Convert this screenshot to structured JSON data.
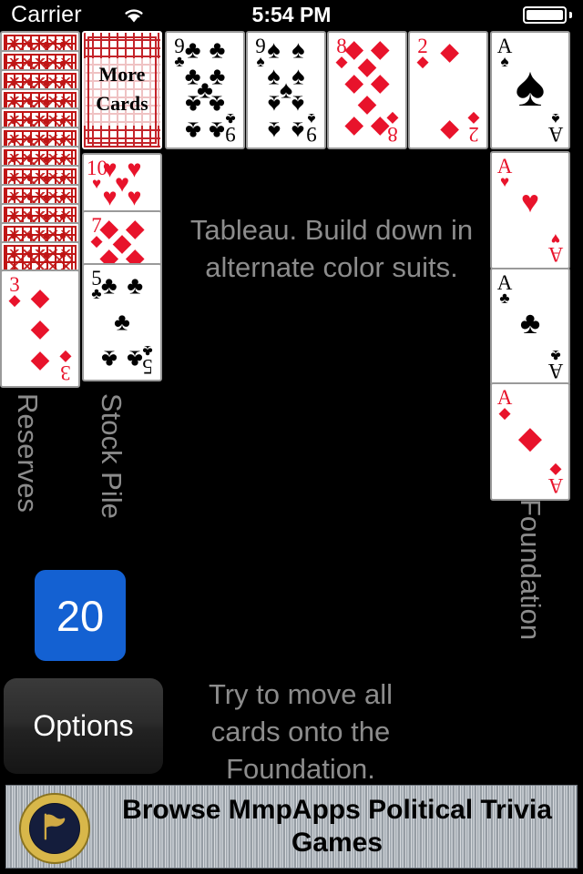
{
  "status_bar": {
    "carrier": "Carrier",
    "time": "5:54 PM",
    "wifi_icon": "wifi-icon",
    "battery_icon": "battery-full-icon"
  },
  "labels": {
    "reserves": "Reserves",
    "stock_pile": "Stock Pile",
    "foundation": "Foundation"
  },
  "hints": {
    "tableau": "Tableau. Build down in alternate color suits.",
    "goal": "Try to move all cards onto the Foundation."
  },
  "stock": {
    "more_cards_line1": "More",
    "more_cards_line2": "Cards"
  },
  "score": {
    "value": "20",
    "color": "#1461d2"
  },
  "options_button": {
    "label": "Options"
  },
  "ad": {
    "text": "Browse MmpApps Political Trivia Games",
    "seal_icon": "presidential-seal-icon"
  },
  "colors": {
    "table": "#000000",
    "label_gray": "#8c8c8c",
    "card_red": "#e8132b",
    "card_back_red": "#c01616",
    "accent_blue": "#1461d2"
  },
  "piles": {
    "reserves": {
      "face_down_count": 12,
      "face_up": [
        {
          "rank": "3",
          "suit": "diamonds",
          "color": "red"
        }
      ]
    },
    "stock_pile": {
      "top_card": "more-cards",
      "face_up": [
        {
          "rank": "10",
          "suit": "hearts",
          "color": "red"
        },
        {
          "rank": "7",
          "suit": "diamonds",
          "color": "red"
        },
        {
          "rank": "5",
          "suit": "clubs",
          "color": "black"
        }
      ]
    },
    "tableau": [
      {
        "rank": "9",
        "suit": "clubs",
        "color": "black"
      },
      {
        "rank": "9",
        "suit": "spades",
        "color": "black"
      },
      {
        "rank": "8",
        "suit": "diamonds",
        "color": "red"
      },
      {
        "rank": "2",
        "suit": "diamonds",
        "color": "red"
      }
    ],
    "foundation": [
      {
        "rank": "A",
        "suit": "spades",
        "color": "black"
      },
      {
        "rank": "A",
        "suit": "hearts",
        "color": "red"
      },
      {
        "rank": "A",
        "suit": "clubs",
        "color": "black"
      },
      {
        "rank": "A",
        "suit": "diamonds",
        "color": "red"
      }
    ]
  }
}
